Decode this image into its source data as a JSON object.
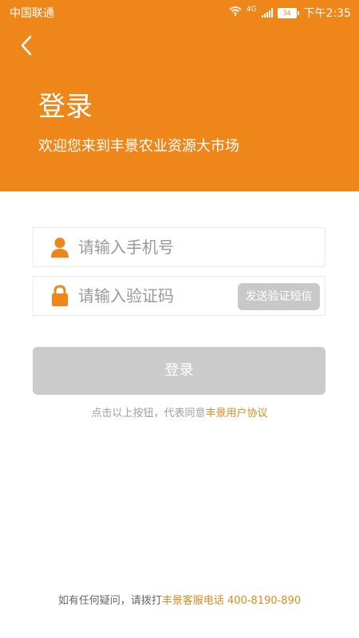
{
  "status_bar": {
    "carrier": "中国联通",
    "network": "4G",
    "battery": "34",
    "time": "下午2:35"
  },
  "header": {
    "title": "登录",
    "subtitle": "欢迎您来到丰景农业资源大市场"
  },
  "form": {
    "phone": {
      "placeholder": "请输入手机号",
      "value": ""
    },
    "code": {
      "placeholder": "请输入验证码",
      "value": ""
    },
    "send_code_label": "发送验证短信",
    "login_label": "登录"
  },
  "agreement": {
    "prefix": "点击以上按钮，代表同意",
    "link": "丰景用户协议"
  },
  "footer": {
    "prefix": "如有任何疑问，请拨打",
    "link": "丰景客服电话 400-8190-890"
  },
  "colors": {
    "brand": "#ef861a",
    "disabled_button": "#cbcbcb",
    "link": "#dd8a1f"
  }
}
